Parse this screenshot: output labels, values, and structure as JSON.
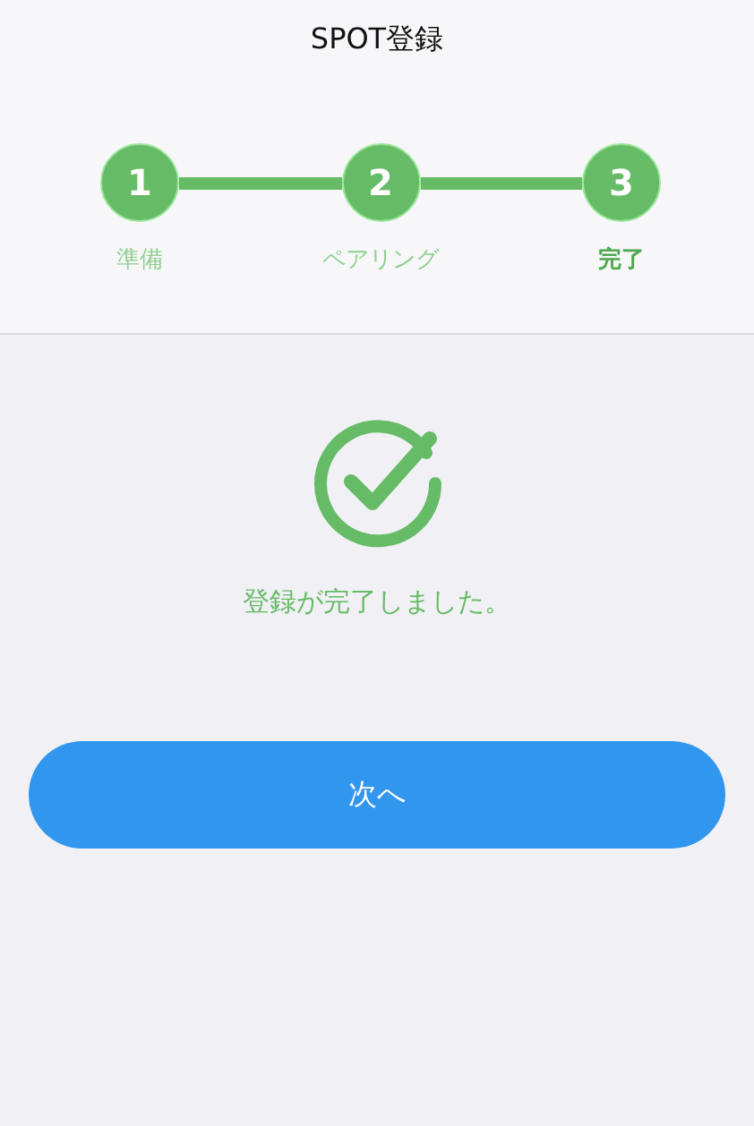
{
  "header": {
    "title": "SPOT登録"
  },
  "steps": [
    {
      "number": "1",
      "label": "準備",
      "selected": false
    },
    {
      "number": "2",
      "label": "ペアリング",
      "selected": false
    },
    {
      "number": "3",
      "label": "完了",
      "selected": true
    }
  ],
  "result": {
    "message": "登録が完了しました。"
  },
  "next_button": {
    "label": "次へ"
  }
}
